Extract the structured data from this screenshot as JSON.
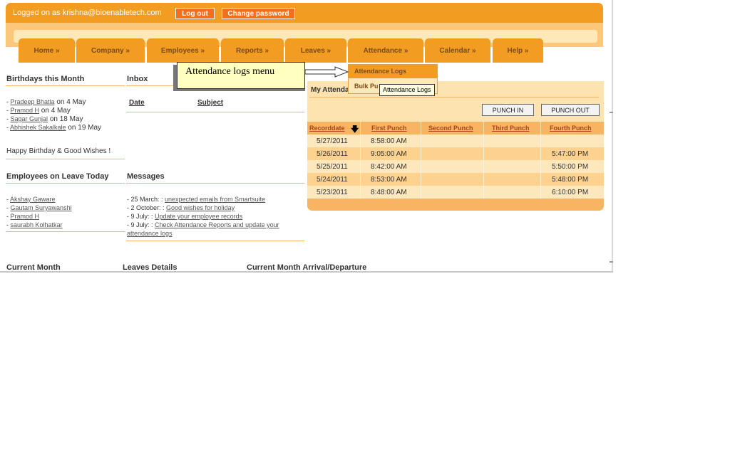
{
  "header": {
    "logged_in_text": "Logged on as krishna@bioenabletech.com",
    "logout_label": "Log out",
    "change_password_label": "Change password"
  },
  "nav": {
    "tabs": [
      {
        "label": "Home »"
      },
      {
        "label": "Company »"
      },
      {
        "label": "Employees »"
      },
      {
        "label": "Reports »"
      },
      {
        "label": "Leaves »"
      },
      {
        "label": "Attendance »"
      },
      {
        "label": "Calendar »"
      },
      {
        "label": "Help »"
      }
    ],
    "dropdown": {
      "items": [
        {
          "label": "Attendance Logs"
        },
        {
          "label": "Bulk Pu"
        }
      ],
      "tooltip": "Attendance Logs"
    }
  },
  "callout": {
    "text": "Attendance logs menu"
  },
  "birthdays": {
    "title": "Birthdays this Month",
    "items": [
      {
        "name": "Pradeep Bhatia",
        "date": " on 4 May"
      },
      {
        "name": "Pramod H",
        "date": " on 4 May"
      },
      {
        "name": "Sagar Gunjal",
        "date": " on 18 May"
      },
      {
        "name": "Abhishek Sakalkale",
        "date": " on 19 May"
      }
    ],
    "wish": "Happy Birthday & Good Wishes !"
  },
  "inbox": {
    "title": "Inbox",
    "col_date": "Date",
    "col_subject": "Subject"
  },
  "leave_today": {
    "title": "Employees on Leave Today",
    "items": [
      "Akshay Gaware",
      "Gautam Suryawanshi",
      "Pramod H",
      "saurabh Kolhatkar"
    ]
  },
  "messages": {
    "title": "Messages",
    "items": [
      {
        "prefix": "- 25 March: : ",
        "link": "unexpected emails from Smartsuite"
      },
      {
        "prefix": "- 2 October: : ",
        "link": "Good wishes for holiday"
      },
      {
        "prefix": "- 9 July: : ",
        "link": "Update your employee records"
      },
      {
        "prefix": "- 9 July: : ",
        "link": "Check Attendance Reports and update your",
        "link2": "attendance logs"
      }
    ]
  },
  "bottom_headings": {
    "current_month": "Current Month",
    "leaves_details": "Leaves Details",
    "arrival_departure": "Current Month Arrival/Departure"
  },
  "attendance": {
    "title": "My Attendance",
    "punch_in_label": "PUNCH IN",
    "punch_out_label": "PUNCH OUT",
    "columns": [
      "Recorddate",
      "First Punch",
      "Second Punch",
      "Third Punch",
      "Fourth Punch"
    ],
    "sort_arrow": "🡇",
    "rows": [
      {
        "date": "5/27/2011",
        "first": "8:58:00 AM",
        "second": "",
        "third": "",
        "fourth": ""
      },
      {
        "date": "5/26/2011",
        "first": "9:05:00 AM",
        "second": "",
        "third": "",
        "fourth": "5:47:00 PM"
      },
      {
        "date": "5/25/2011",
        "first": "8:42:00 AM",
        "second": "",
        "third": "",
        "fourth": "5:50:00 PM"
      },
      {
        "date": "5/24/2011",
        "first": "8:53:00 AM",
        "second": "",
        "third": "",
        "fourth": "5:48:00 PM"
      },
      {
        "date": "5/23/2011",
        "first": "8:48:00 AM",
        "second": "",
        "third": "",
        "fourth": "6:10:00 PM"
      }
    ]
  }
}
